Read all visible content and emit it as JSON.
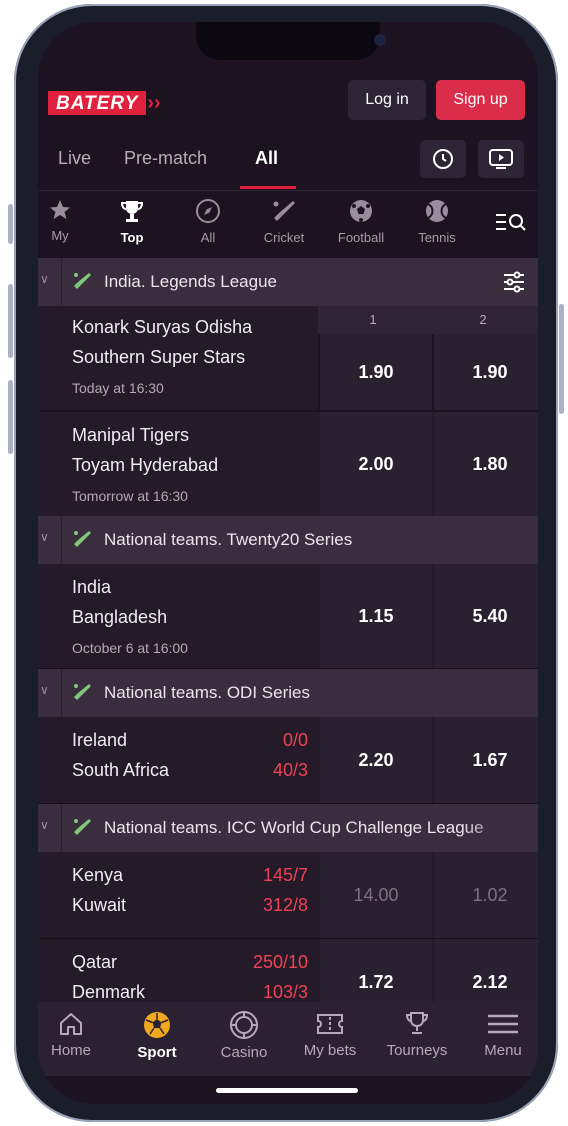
{
  "header": {
    "logo": "BATERY",
    "login_label": "Log in",
    "signup_label": "Sign up"
  },
  "tabs": [
    {
      "label": "Live"
    },
    {
      "label": "Pre-match"
    },
    {
      "label": "All",
      "active": true
    }
  ],
  "sports": [
    {
      "label": "My",
      "icon": "star-icon"
    },
    {
      "label": "Top",
      "icon": "trophy-icon",
      "active": true
    },
    {
      "label": "All",
      "icon": "compass-icon"
    },
    {
      "label": "Cricket",
      "icon": "cricket-icon"
    },
    {
      "label": "Football",
      "icon": "football-icon"
    },
    {
      "label": "Tennis",
      "icon": "tennis-icon"
    }
  ],
  "leagues": [
    {
      "name": "India. Legends League",
      "col1": "1",
      "col2": "2",
      "matches": [
        {
          "home": "Konark Suryas Odisha",
          "away": "Southern Super Stars",
          "time": "Today at 16:30",
          "odd1": "1.90",
          "odd2": "1.90"
        },
        {
          "home": "Manipal Tigers",
          "away": "Toyam Hyderabad",
          "time": "Tomorrow at 16:30",
          "odd1": "2.00",
          "odd2": "1.80"
        }
      ]
    },
    {
      "name": "National teams. Twenty20 Series",
      "matches": [
        {
          "home": "India",
          "away": "Bangladesh",
          "time": "October 6 at 16:00",
          "odd1": "1.15",
          "odd2": "5.40"
        }
      ]
    },
    {
      "name": "National teams. ODI Series",
      "matches": [
        {
          "home": "Ireland",
          "away": "South Africa",
          "score_home": "0/0",
          "score_away": "40/3",
          "odd1": "2.20",
          "odd2": "1.67"
        }
      ]
    },
    {
      "name": "National teams. ICC World Cup Challenge League",
      "matches": [
        {
          "home": "Kenya",
          "away": "Kuwait",
          "score_home": "145/7",
          "score_away": "312/8",
          "odd1": "14.00",
          "odd2": "1.02"
        },
        {
          "home": "Qatar",
          "away": "Denmark",
          "score_home": "250/10",
          "score_away": "103/3",
          "odd1": "1.72",
          "odd2": "2.12"
        }
      ]
    }
  ],
  "bottom_nav": [
    {
      "label": "Home",
      "icon": "home-icon"
    },
    {
      "label": "Sport",
      "icon": "sport-ball-icon",
      "active": true
    },
    {
      "label": "Casino",
      "icon": "casino-chip-icon"
    },
    {
      "label": "My bets",
      "icon": "ticket-icon"
    },
    {
      "label": "Tourneys",
      "icon": "trophy-icon"
    },
    {
      "label": "Menu",
      "icon": "menu-icon"
    }
  ],
  "colors": {
    "accent": "#e0213d",
    "background": "#1c1220",
    "score": "#ee4257"
  }
}
